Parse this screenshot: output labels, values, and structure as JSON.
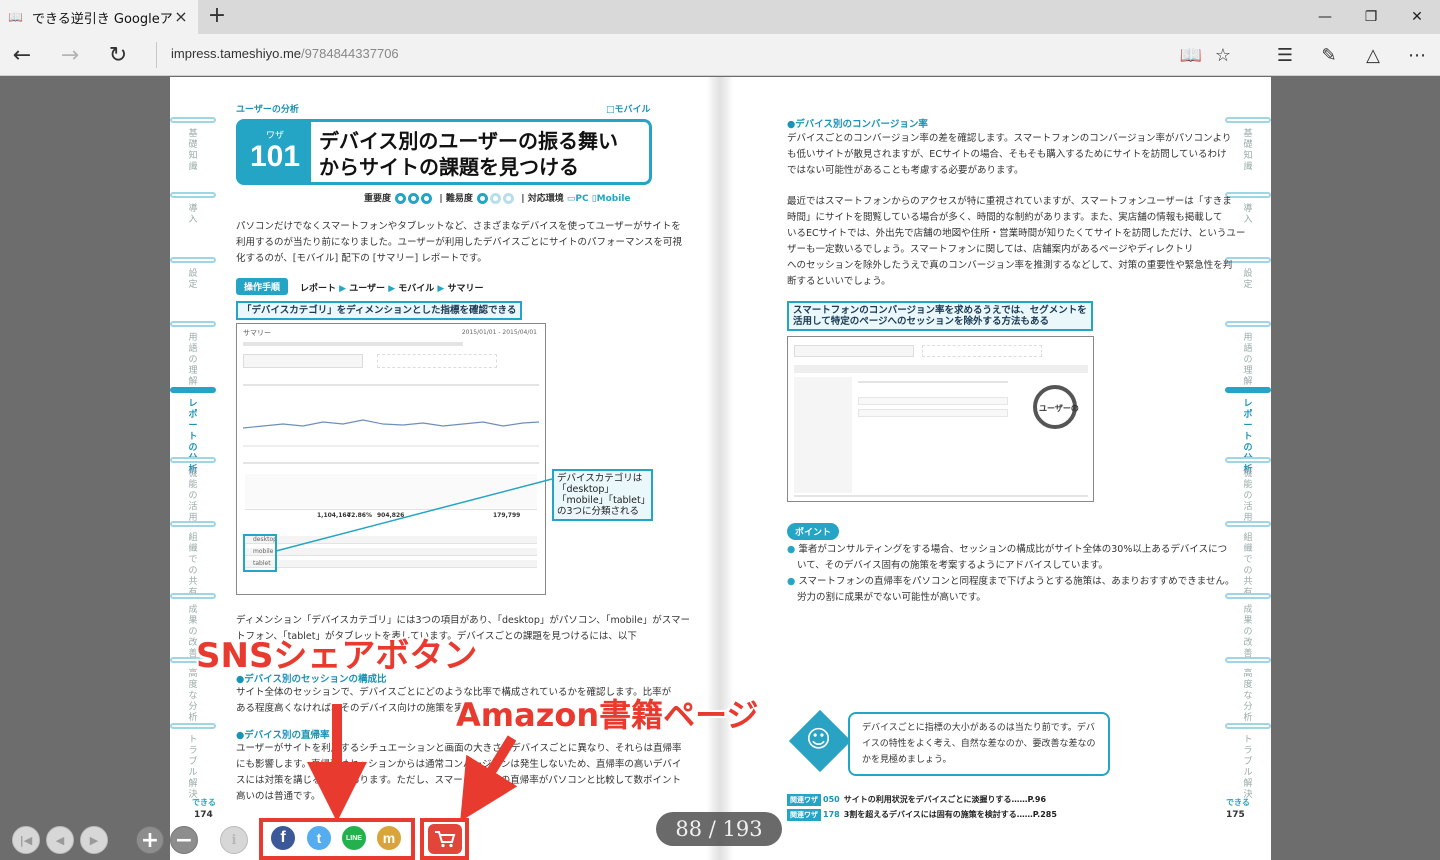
{
  "browser": {
    "tab_title": "できる逆引き Googleアナ!",
    "url_host": "impress.tameshiyo.me",
    "url_path": "/9784844337706"
  },
  "book": {
    "left": {
      "section": "ユーザーの分析",
      "device_tag": "モバイル",
      "waza_label": "ワザ",
      "waza_number": "101",
      "title_line1": "デバイス別のユーザーの振る舞い",
      "title_line2": "からサイトの課題を見つける",
      "importance_label": "重要度",
      "difficulty_label": "難易度",
      "env_label": "対応環境",
      "env_pc": "PC",
      "env_mobile": "Mobile",
      "intro_1": "パソコンだけでなくスマートフォンやタブレットなど、さまざまなデバイスを使ってユーザーがサイトを",
      "intro_2": "利用するのが当たり前になりました。ユーザーが利用したデバイスごとにサイトのパフォーマンスを可視",
      "intro_3": "化するのが、[モバイル] 配下の [サマリー] レポートです。",
      "steps_label": "操作手順",
      "bc_1": "レポート",
      "bc_2": "ユーザー",
      "bc_3": "モバイル",
      "bc_4": "サマリー",
      "callout": "「デバイスカテゴリ」をディメンションとした指標を確認できる",
      "shot_title": "サマリー",
      "shot_date": "2015/01/01 - 2015/04/01",
      "shot_row1": "1,104,164",
      "shot_row2": "72.86%",
      "shot_row3": "904,826",
      "shot_row4": "179,799",
      "shot_d1": "desktop",
      "shot_d2": "mobile",
      "shot_d3": "tablet",
      "annotation": "デバイスカテゴリは「desktop」「mobile」「tablet」の3つに分類される",
      "para2_1": "ディメンション「デバイスカテゴリ」には3つの項目があり、「desktop」がパソコン、「mobile」がスマー",
      "para2_2": "トフォン、「tablet」がタブレットを表しています。デバイスごとの課題を見つけるには、以下",
      "h_session": "●デバイス別のセッションの構成比",
      "session_1": "サイト全体のセッションで、デバイスごとにどのような比率で構成されているかを確認します。比率が",
      "session_2": "ある程度高くなければ、そのデバイス向けの施策を実施",
      "h_bounce": "●デバイス別の直帰率",
      "bounce_1": "ユーザーがサイトを利用するシチュエーションと画面の大きさはデバイスごとに異なり、それらは直帰率",
      "bounce_2": "にも影響します。直帰率はセッションからは通常コンバージョンは発生しないため、直帰率の高いデバイ",
      "bounce_3": "スには対策を講じる必要があります。ただし、スマートフォンの直帰率がパソコンと比較して数ポイント",
      "bounce_4": "高いのは普通です。",
      "dekiru": "できる",
      "page_number": "174"
    },
    "right": {
      "h_cv": "●デバイス別のコンバージョン率",
      "cv_1": "デバイスごとのコンバージョン率の差を確認します。スマートフォンのコンバージョン率がパソコンより",
      "cv_2": "も低いサイトが散見されますが、ECサイトの場合、そもそも購入するためにサイトを訪問しているわけ",
      "cv_3": "ではない可能性があることも考慮する必要があります。",
      "p2_1": "最近ではスマートフォンからのアクセスが特に重視されていますが、スマートフォンユーザーは「すきま",
      "p2_2": "時間」にサイトを閲覧している場合が多く、時間的な制約があります。また、実店舗の情報も掲載して",
      "p2_3": "いるECサイトでは、外出先で店舗の地図や住所・営業時間が知りたくてサイトを訪問しただけ、というユー",
      "p2_4": "ザーも一定数いるでしょう。スマートフォンに関しては、店舗案内があるページやディレクトリ",
      "p2_5": "へのセッションを除外したうえで真のコンバージョン率を推測するなどして、対策の重要性や緊急性を判",
      "p2_6": "断するといいでしょう。",
      "callout_1": "スマートフォンのコンバージョン率を求めるうえでは、セグメントを",
      "callout_2": "活用して特定のページへのセッションを除外する方法もある",
      "shot_gauge": "ユーザーの",
      "point_label": "ポイント",
      "point_1a": "筆者がコンサルティングをする場合、セッションの構成比がサイト全体の30%以上あるデバイスにつ",
      "point_1b": "いて、そのデバイス固有の施策を考案するようにアドバイスしています。",
      "point_2a": "スマートフォンの直帰率をパソコンと同程度まで下げようとする施策は、あまりおすすめできません。",
      "point_2b": "労力の割に成果がでない可能性が高いです。",
      "speech_1": "デバイスごとに指標の大小があるのは当たり前です。デバ",
      "speech_2": "イスの特性をよく考え、自然な差なのか、要改善な差なの",
      "speech_3": "かを見極めましょう。",
      "related_tag": "関連ワザ",
      "related_1_num": "050",
      "related_1": "サイトの利用状況をデバイスごとに淡握りする……P.96",
      "related_2_num": "178",
      "related_2": "3割を超えるデバイスには固有の施策を検討する……P.285",
      "dekiru": "できる",
      "page_number": "175"
    },
    "side_tabs": [
      "基礎知識",
      "導入",
      "設定",
      "用語の理解",
      "レポートの分析",
      "機能の活用",
      "組織での共有",
      "成果の改善",
      "高度な分析",
      "トラブル解決"
    ],
    "active_side_tab": "レポートの分析"
  },
  "overlays": {
    "sns_label": "SNSシェアボタン",
    "amazon_label": "Amazon書籍ページ",
    "color": "#e83a2f"
  },
  "controls": {
    "first_page_icon": "first-page-icon",
    "prev_page_icon": "prev-page-icon",
    "next_page_icon": "next-page-icon",
    "zoom_in": "+",
    "zoom_out": "−",
    "info": "i",
    "sns": {
      "facebook": "f",
      "twitter": "t",
      "line": "LINE",
      "mixi": "m"
    },
    "page_counter": "88 / 193"
  }
}
